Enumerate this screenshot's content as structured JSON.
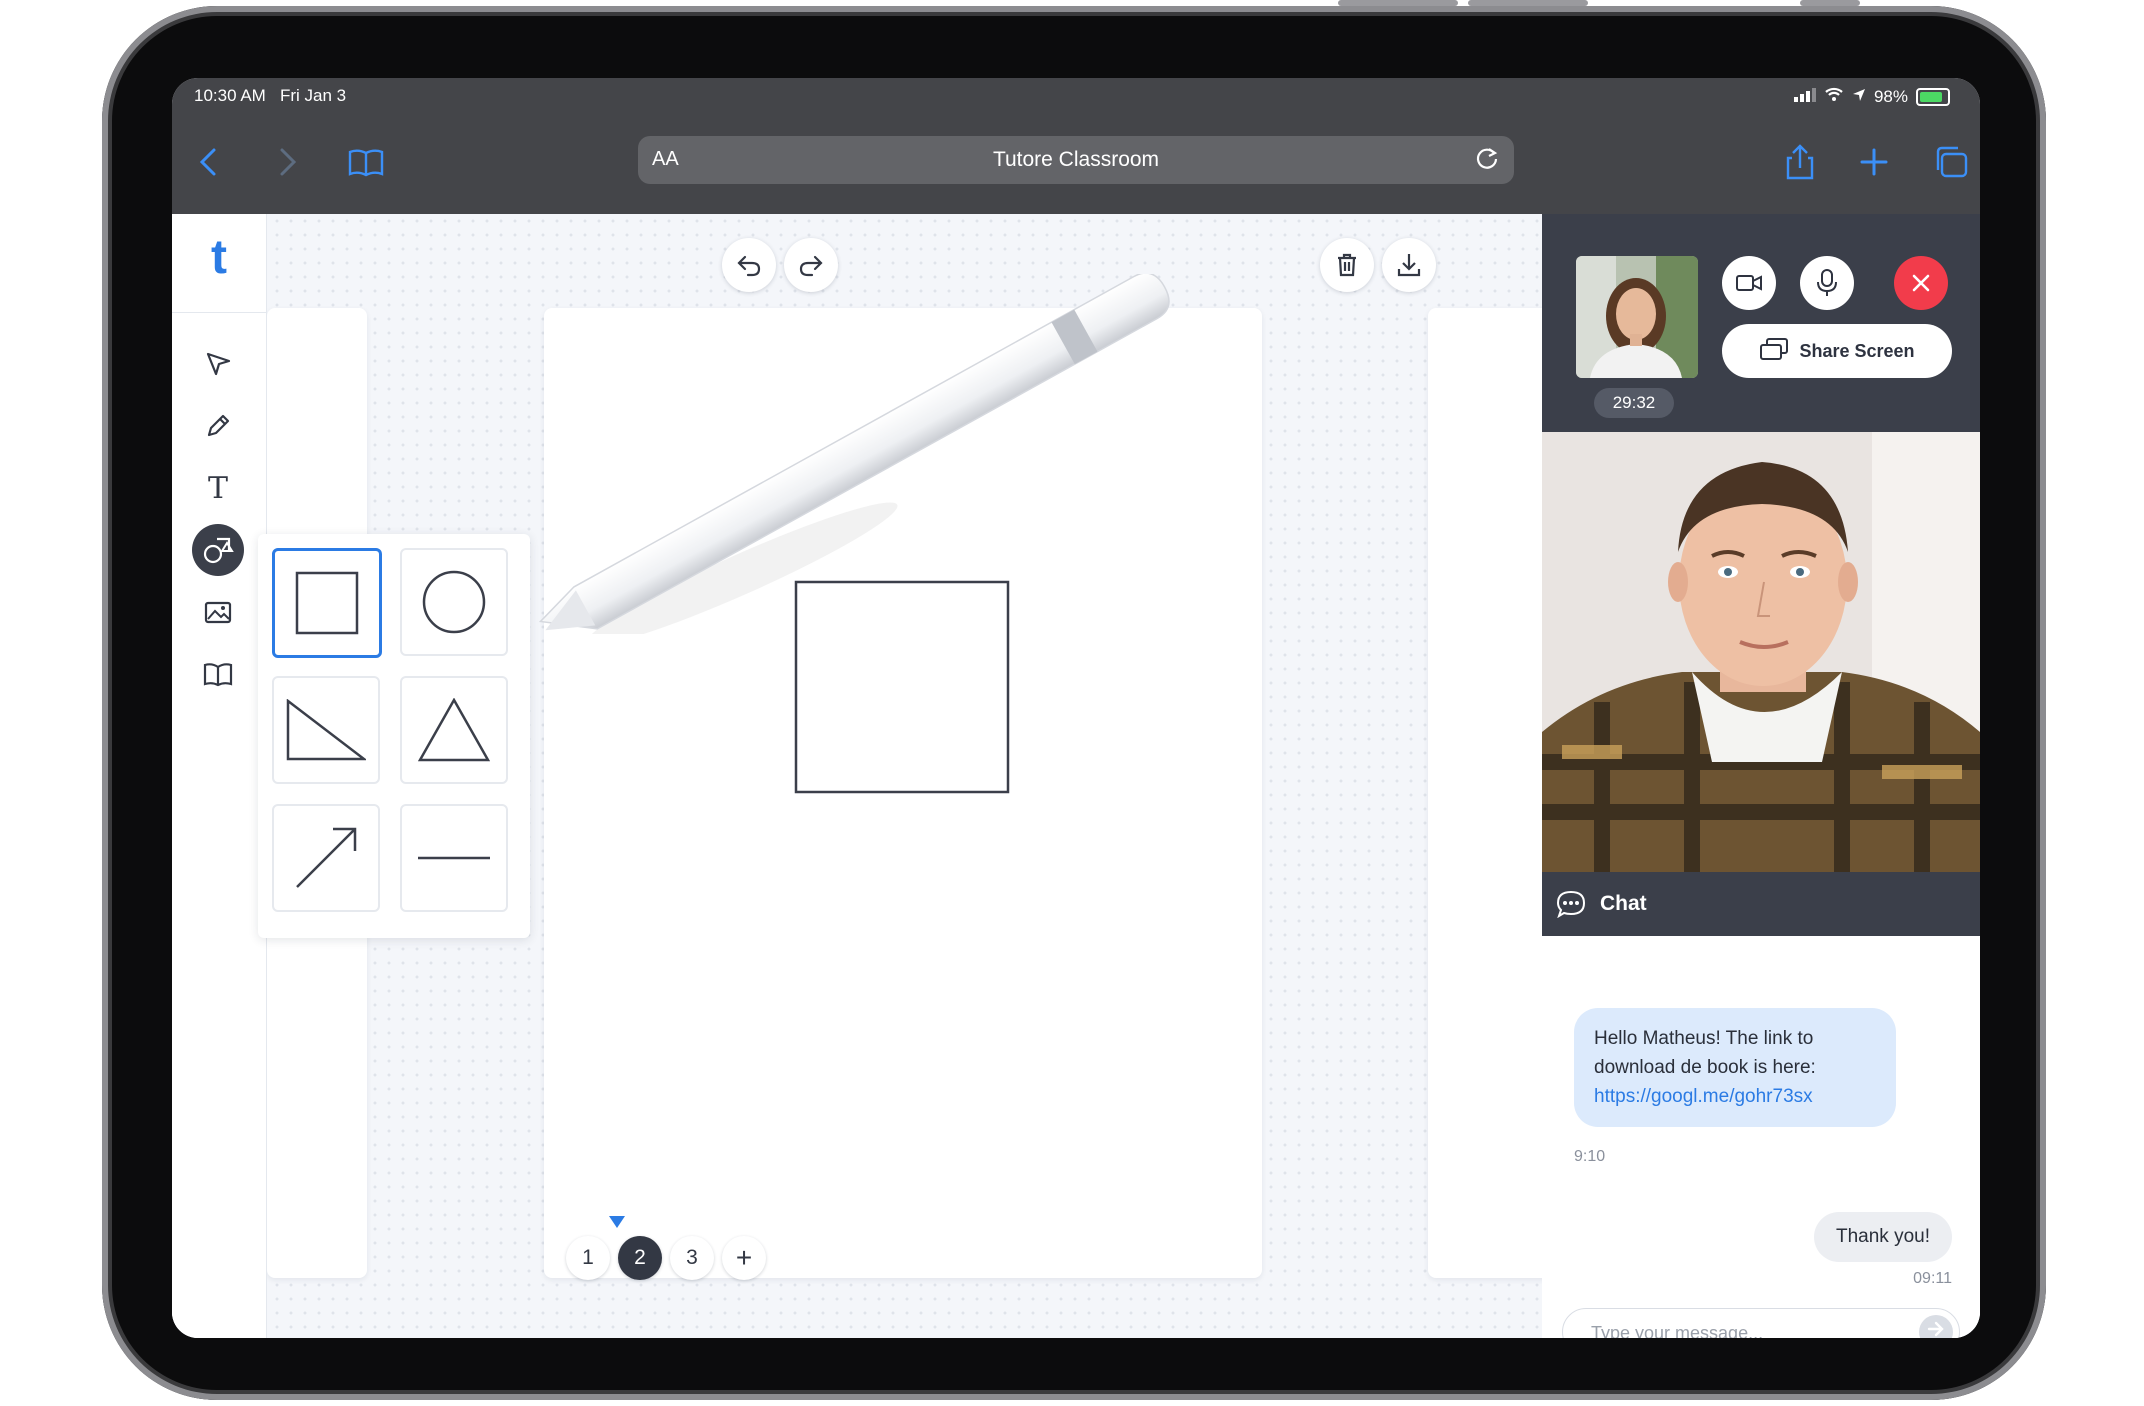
{
  "status_bar": {
    "time": "10:30 AM",
    "date": "Fri Jan 3",
    "battery": "98%"
  },
  "browser": {
    "text_size_label": "AA",
    "page_title": "Tutore Classroom"
  },
  "app": {
    "logo": "t"
  },
  "toolbar": {
    "tools": [
      "pointer-icon",
      "pencil-icon",
      "text-icon",
      "shapes-icon",
      "image-icon",
      "book-icon"
    ],
    "active_tool": "shapes-icon",
    "text_tool_glyph": "T"
  },
  "shape_panel": {
    "shapes": [
      "square-icon",
      "circle-icon",
      "right-triangle-icon",
      "triangle-icon",
      "arrow-icon",
      "line-icon"
    ],
    "selected": "square-icon"
  },
  "pagination": {
    "pages": [
      "1",
      "2",
      "3"
    ],
    "current": "2",
    "add": "+"
  },
  "call": {
    "timer": "29:32",
    "share_label": "Share Screen",
    "end_color": "#f23c4b"
  },
  "chat": {
    "title": "Chat",
    "messages": [
      {
        "text": "Hello Matheus! The link to download de book is here:",
        "link": "https://googl.me/gohr73sx",
        "time": "9:10"
      },
      {
        "text": "Thank you!",
        "time": "09:11"
      }
    ],
    "input_placeholder": "Type your message..."
  },
  "colors": {
    "accent": "#2b7be4",
    "dark": "#3b3f4a",
    "browser_bar": "#444549"
  }
}
